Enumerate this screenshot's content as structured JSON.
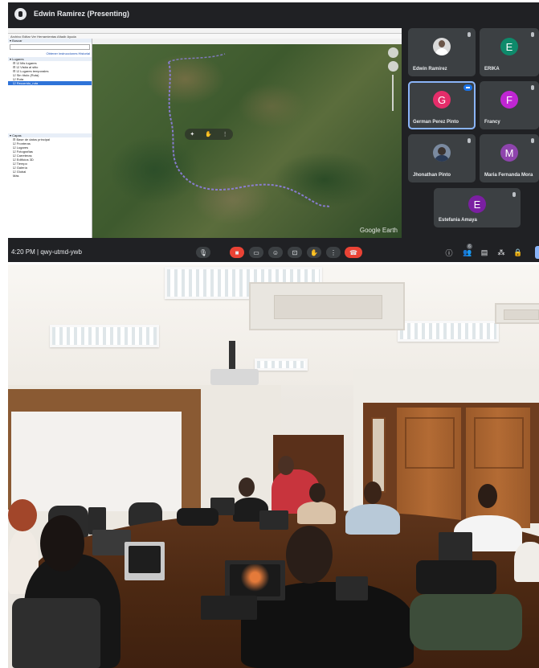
{
  "meet": {
    "presenter_label": "Edwin Ramirez (Presenting)",
    "time": "4:20 PM",
    "separator": "|",
    "meeting_code": "qwy-utmd-ywb",
    "participant_count": "6",
    "participants": [
      {
        "name": "Edwin Ramirez",
        "avatar_type": "photo",
        "initial": "",
        "color": "#d9d9d9"
      },
      {
        "name": "ERIKA",
        "avatar_type": "initial",
        "initial": "E",
        "color": "#0e8a6b"
      },
      {
        "name": "German Perez Pinto",
        "avatar_type": "initial",
        "initial": "G",
        "color": "#e52d6a"
      },
      {
        "name": "Francy",
        "avatar_type": "initial",
        "initial": "F",
        "color": "#c026d3"
      },
      {
        "name": "Jhonathan Pinto",
        "avatar_type": "photo",
        "initial": "",
        "color": "#7a8aa0"
      },
      {
        "name": "Maria Fernanda Mora",
        "avatar_type": "initial",
        "initial": "M",
        "color": "#8e44ad"
      },
      {
        "name": "Estefania Amaya",
        "avatar_type": "initial",
        "initial": "E",
        "color": "#7b1fa2"
      }
    ],
    "active_speaker": "German Perez Pinto",
    "controls": {
      "mic": "mic-icon",
      "camera_off": "camera-off-icon",
      "captions": "captions-icon",
      "emoji": "emoji-icon",
      "present": "present-icon",
      "raise_hand": "hand-icon",
      "more": "more-icon",
      "end_call": "end-call-icon"
    },
    "right_controls": [
      "info-icon",
      "people-icon",
      "chat-icon",
      "activities-icon",
      "lock-icon"
    ],
    "colors": {
      "background": "#202124",
      "tile": "#3c4043",
      "end_call": "#ea4335",
      "accent": "#8ab4f8"
    }
  },
  "google_earth": {
    "menu": "Archivo  Editar  Ver  Herramientas  Añadir  Ayuda",
    "search_title": "▾ Buscar",
    "search_links": "Obtener instrucciones  Historial",
    "places_title": "▾ Lugares",
    "places_items": [
      "⊟ ☑ Mis lugares",
      "  ⊟ ☑ Visita al sitio",
      "  ⊟ ☑ Lugares temporales",
      "    ☑ Sin título (Ruta)",
      "    ☑ Ruta",
      "    ☑ Recorrido_ruta"
    ],
    "selected_item": "    ☑ Recorrido_ruta",
    "layers_title": "▾ Capas",
    "layers_items": [
      "⊟ Base de datos principal",
      "  ☑ Fronteras",
      "  ☑ Lugares",
      "  ☑ Fotografías",
      "  ☑ Carreteras",
      "  ☑ Edificios 3D",
      "  ☑ Tiempo",
      "  ☑ Galería",
      "  ☑ Global",
      "  Más"
    ],
    "logo": "Google Earth",
    "map_icon": "earth-map-icon"
  },
  "room_photo": {
    "description_icon": "classroom-photo"
  }
}
